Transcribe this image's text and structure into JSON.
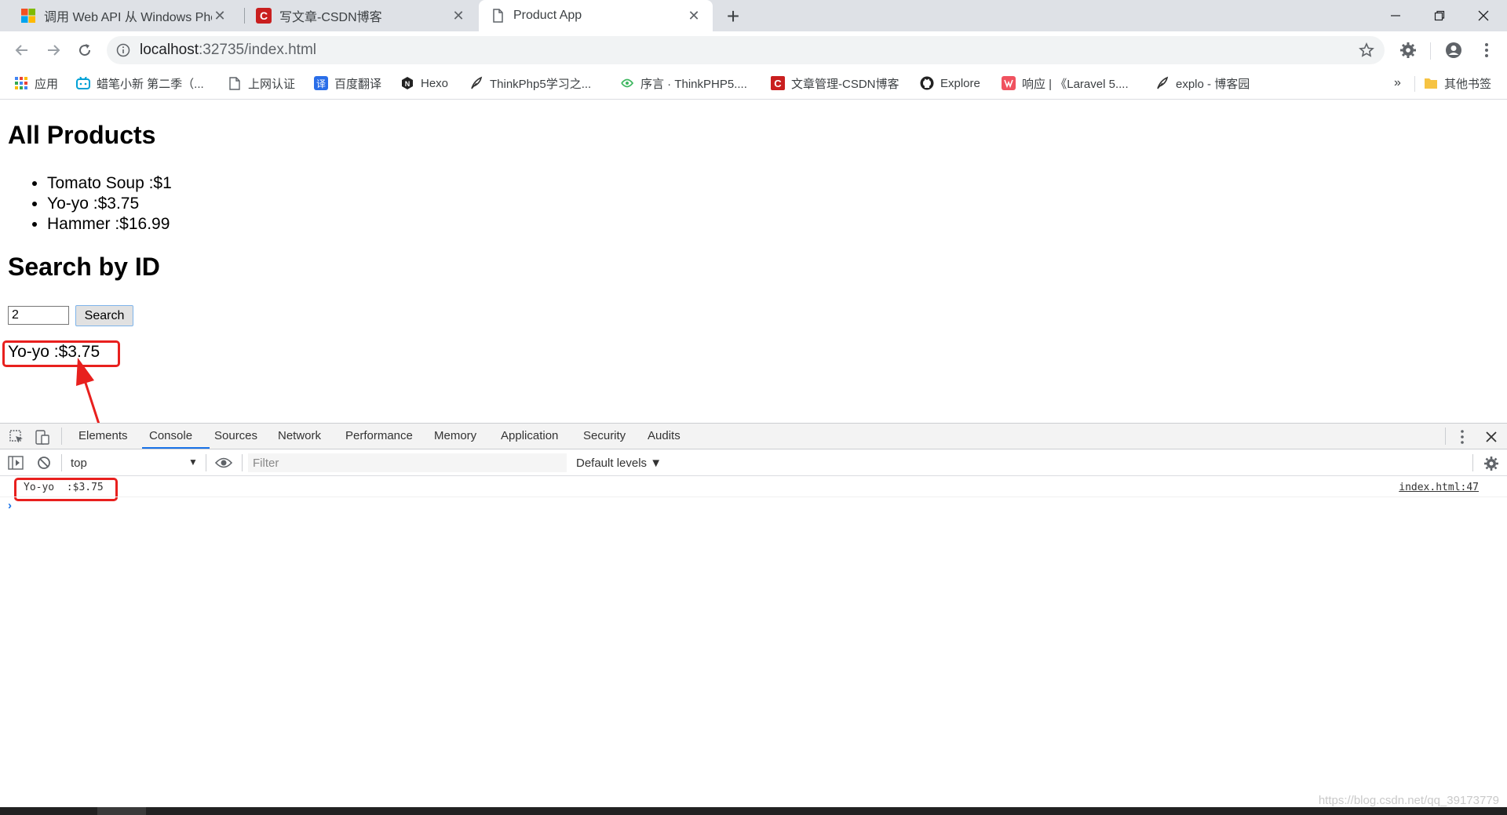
{
  "browser": {
    "tabs": [
      {
        "title": "调用 Web API 从 Windows Pho",
        "active": false
      },
      {
        "title": "写文章-CSDN博客",
        "active": false
      },
      {
        "title": "Product App",
        "active": true
      }
    ],
    "new_tab": "+",
    "url_host": "localhost",
    "url_rest": ":32735/index.html"
  },
  "bookmarks": [
    {
      "label": "应用",
      "icon": "apps-grid-icon"
    },
    {
      "label": "蜡笔小新 第二季（...",
      "icon": "bilibili-icon"
    },
    {
      "label": "上网认证",
      "icon": "page-icon"
    },
    {
      "label": "百度翻译",
      "icon": "translate-icon"
    },
    {
      "label": "Hexo",
      "icon": "hexo-icon"
    },
    {
      "label": "ThinkPhp5学习之...",
      "icon": "feather-icon"
    },
    {
      "label": "序言 · ThinkPHP5....",
      "icon": "kancloud-icon"
    },
    {
      "label": "文章管理-CSDN博客",
      "icon": "csdn-icon"
    },
    {
      "label": "Explore",
      "icon": "github-icon"
    },
    {
      "label": "响应 | 《Laravel 5....",
      "icon": "laravel-icon"
    },
    {
      "label": "explo - 博客园",
      "icon": "feather-icon"
    }
  ],
  "bookmarks_more": "»",
  "other_bookmarks": "其他书签",
  "page": {
    "heading_all": "All Products",
    "products": [
      "Tomato Soup :$1",
      "Yo-yo :$3.75",
      "Hammer :$16.99"
    ],
    "heading_search": "Search by ID",
    "search_value": "2",
    "search_button": "Search",
    "result": "Yo-yo :$3.75"
  },
  "devtools": {
    "tabs": [
      "Elements",
      "Console",
      "Sources",
      "Network",
      "Performance",
      "Memory",
      "Application",
      "Security",
      "Audits"
    ],
    "active_tab": "Console",
    "context": "top",
    "filter_placeholder": "Filter",
    "levels": "Default levels ▼",
    "message": "Yo-yo  :$3.75",
    "message_source": "index.html:47",
    "prompt": "›"
  },
  "watermark": "https://blog.csdn.net/qq_39173779",
  "colors": {
    "highlight_red": "#e8201e",
    "tabstrip": "#dee1e6",
    "devtools_toolbar": "#f3f3f3"
  }
}
